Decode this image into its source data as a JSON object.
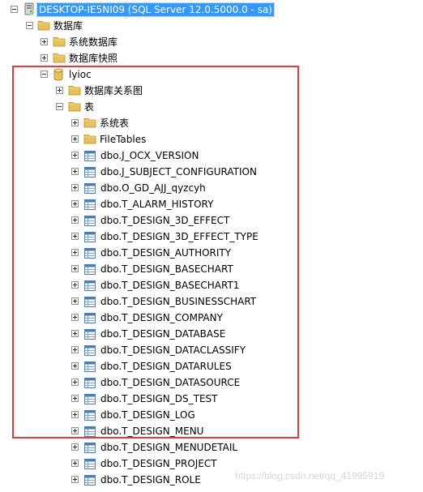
{
  "tree": {
    "server": "DESKTOP-IE5NI09 (SQL Server 12.0.5000.0 - sa)",
    "databases_folder": "数据库",
    "system_databases": "系统数据库",
    "database_snapshots": "数据库快照",
    "database": "lyioc",
    "diagrams_folder": "数据库关系图",
    "tables_folder": "表",
    "system_tables": "系统表",
    "file_tables": "FileTables",
    "tables": [
      "dbo.J_OCX_VERSION",
      "dbo.J_SUBJECT_CONFIGURATION",
      "dbo.O_GD_AJJ_qyzcyh",
      "dbo.T_ALARM_HISTORY",
      "dbo.T_DESIGN_3D_EFFECT",
      "dbo.T_DESIGN_3D_EFFECT_TYPE",
      "dbo.T_DESIGN_AUTHORITY",
      "dbo.T_DESIGN_BASECHART",
      "dbo.T_DESIGN_BASECHART1",
      "dbo.T_DESIGN_BUSINESSCHART",
      "dbo.T_DESIGN_COMPANY",
      "dbo.T_DESIGN_DATABASE",
      "dbo.T_DESIGN_DATACLASSIFY",
      "dbo.T_DESIGN_DATARULES",
      "dbo.T_DESIGN_DATASOURCE",
      "dbo.T_DESIGN_DS_TEST",
      "dbo.T_DESIGN_LOG",
      "dbo.T_DESIGN_MENU",
      "dbo.T_DESIGN_MENUDETAIL",
      "dbo.T_DESIGN_PROJECT",
      "dbo.T_DESIGN_ROLE"
    ]
  },
  "watermark": "https://blog.csdn.net/qq_41995919",
  "colors": {
    "selection": "#3399ff",
    "highlight_box": "#e8383d",
    "folder": "#e8c15a",
    "table_icon": "#4a7ebb"
  },
  "icons": {
    "server": "server-icon",
    "folder": "folder-icon",
    "database": "database-icon",
    "table": "table-icon",
    "expander_expanded": "collapse-icon",
    "expander_collapsed": "expand-icon"
  }
}
